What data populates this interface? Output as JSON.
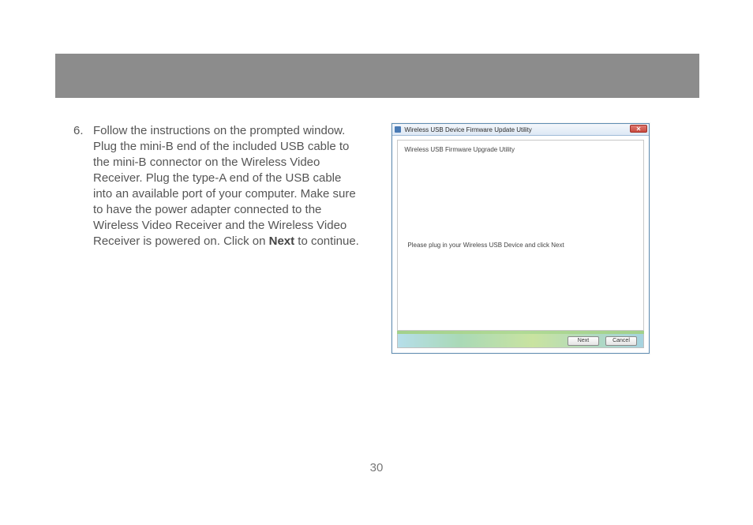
{
  "step": {
    "number": "6.",
    "text_before_bold": "Follow the instructions on the prompted window.  Plug the mini-B end of the included USB cable to the mini-B connector on the Wireless Video Receiver.  Plug the type-A end of the USB cable into an available port of your computer.  Make sure to have the power adapter connected to the Wireless Video Receiver and the Wireless Video Receiver is powered on.  Click on ",
    "bold": "Next",
    "text_after_bold": " to continue."
  },
  "dialog": {
    "title": "Wireless USB Device Firmware Update Utility",
    "subtitle": "Wireless USB Firmware Upgrade Utility",
    "instruction": "Please plug in your Wireless USB Device and click Next",
    "buttons": {
      "next": "Next",
      "cancel": "Cancel"
    }
  },
  "page_number": "30"
}
